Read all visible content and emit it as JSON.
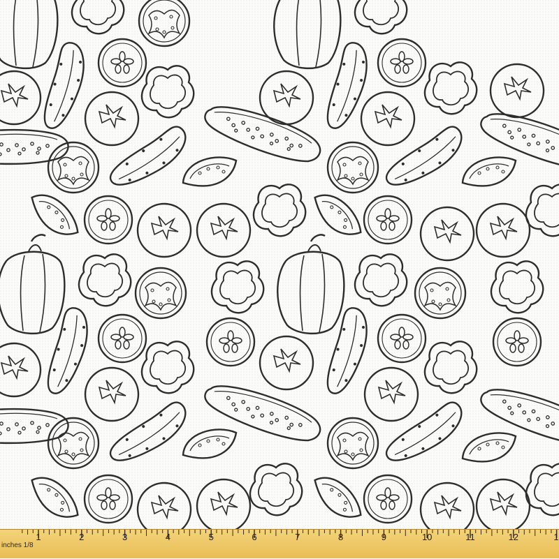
{
  "image": {
    "subject": "black-and-white line-drawn vegetable pattern on fabric",
    "background_color": "#fbfbf9",
    "ink_color": "#2d2d2d"
  },
  "ruler": {
    "unit_label": "inches 1/8",
    "numbers": [
      "1",
      "2",
      "3",
      "4",
      "5",
      "6",
      "7",
      "8",
      "9",
      "10",
      "11",
      "12",
      "1"
    ],
    "colors": {
      "fill": "#efc965",
      "tick": "#3a2a12"
    }
  }
}
